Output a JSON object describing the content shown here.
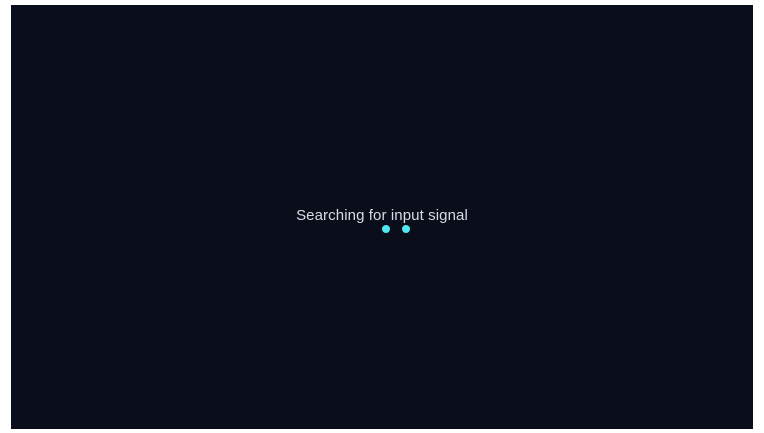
{
  "screen": {
    "status_text": "Searching for input signal",
    "background_color": "#0a0e1b",
    "loading_indicator": {
      "dot_count": 2,
      "dot_color": "#4fe8f0"
    }
  }
}
